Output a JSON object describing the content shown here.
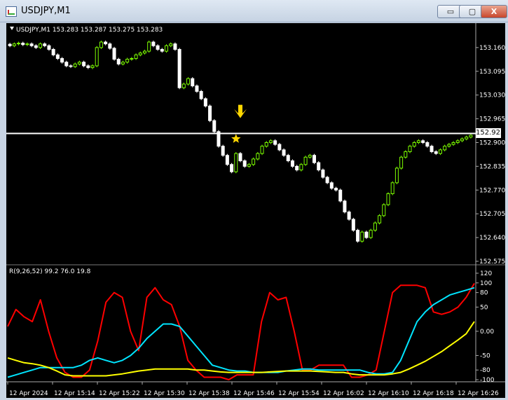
{
  "window": {
    "title": "USDJPY,M1",
    "buttons": {
      "minimize": "▭",
      "maximize": "▢",
      "close": "X"
    }
  },
  "colors": {
    "background": "#000000",
    "bull": "#7cfc00",
    "bear": "#ffffff",
    "red_line": "#ff0000",
    "cyan_line": "#00e5ff",
    "yellow_line": "#ffff00",
    "current_price_line": "#ffffff",
    "marker": "#ffd700"
  },
  "chart_data": [
    {
      "type": "candlestick",
      "title": "USDJPY,M1  153.283 153.287 153.275 153.283",
      "symbol": "USDJPY,M1",
      "ohlc_header": {
        "open": "153.283",
        "high": "153.287",
        "low": "153.275",
        "close": "153.283"
      },
      "ylim": [
        152.575,
        153.2
      ],
      "y_ticks": [
        "153.160",
        "153.095",
        "153.030",
        "152.965",
        "152.900",
        "152.835",
        "152.770",
        "152.705",
        "152.640",
        "152.575"
      ],
      "current_price": "152.925",
      "markers": [
        {
          "type": "arrow-down",
          "bar": 53,
          "price": 152.965
        },
        {
          "type": "star",
          "bar": 52,
          "price": 152.91
        }
      ],
      "closes": [
        153.165,
        153.17,
        153.172,
        153.168,
        153.17,
        153.165,
        153.16,
        153.17,
        153.165,
        153.155,
        153.14,
        153.13,
        153.12,
        153.11,
        153.108,
        153.115,
        153.12,
        153.11,
        153.105,
        153.11,
        153.16,
        153.175,
        153.17,
        153.158,
        153.128,
        153.115,
        153.12,
        153.128,
        153.13,
        153.14,
        153.145,
        153.15,
        153.175,
        153.165,
        153.155,
        153.15,
        153.165,
        153.17,
        153.155,
        153.05,
        153.06,
        153.075,
        153.055,
        153.04,
        153.02,
        153.0,
        152.96,
        152.93,
        152.89,
        152.865,
        152.84,
        152.82,
        152.87,
        152.85,
        152.835,
        152.84,
        152.855,
        152.87,
        152.89,
        152.9,
        152.905,
        152.895,
        152.88,
        152.865,
        152.85,
        152.835,
        152.825,
        152.84,
        152.86,
        152.865,
        152.845,
        152.825,
        152.805,
        152.79,
        152.775,
        152.77,
        152.74,
        152.71,
        152.69,
        152.66,
        152.63,
        152.655,
        152.64,
        152.66,
        152.68,
        152.7,
        152.73,
        152.76,
        152.79,
        152.83,
        152.86,
        152.875,
        152.89,
        152.9,
        152.905,
        152.9,
        152.89,
        152.875,
        152.87,
        152.88,
        152.89,
        152.895,
        152.9,
        152.905,
        152.91,
        152.915,
        152.92
      ]
    },
    {
      "type": "line",
      "title": "R(9,26,52) 99.2 76.0 19.8",
      "ylim": [
        -100,
        120
      ],
      "y_ticks": [
        "120",
        "100",
        "80",
        "50",
        "0.00",
        "-50",
        "-80",
        "-100"
      ],
      "x_tick_labels": [
        "12 Apr 2024",
        "12 Apr 15:14",
        "12 Apr 15:22",
        "12 Apr 15:30",
        "12 Apr 15:38",
        "12 Apr 15:46",
        "12 Apr 15:54",
        "12 Apr 16:02",
        "12 Apr 16:10",
        "12 Apr 16:18",
        "12 Apr 16:26"
      ],
      "series": [
        {
          "color": "#ff0000",
          "values": [
            10,
            45,
            30,
            20,
            65,
            0,
            -55,
            -85,
            -95,
            -95,
            -80,
            -20,
            60,
            80,
            70,
            0,
            -40,
            70,
            90,
            65,
            55,
            10,
            -60,
            -80,
            -95,
            -95,
            -95,
            -100,
            -90,
            -90,
            -90,
            20,
            80,
            65,
            70,
            0,
            -80,
            -80,
            -70,
            -70,
            -70,
            -70,
            -95,
            -95,
            -90,
            -80,
            0,
            80,
            95,
            95,
            95,
            90,
            40,
            35,
            40,
            50,
            70,
            99
          ]
        },
        {
          "color": "#00e5ff",
          "values": [
            -95,
            -90,
            -85,
            -80,
            -75,
            -75,
            -75,
            -75,
            -75,
            -70,
            -60,
            -55,
            -60,
            -65,
            -60,
            -50,
            -35,
            -15,
            0,
            15,
            15,
            10,
            -10,
            -30,
            -50,
            -70,
            -75,
            -80,
            -82,
            -82,
            -85,
            -85,
            -85,
            -85,
            -82,
            -80,
            -78,
            -78,
            -80,
            -80,
            -80,
            -80,
            -80,
            -80,
            -85,
            -88,
            -88,
            -85,
            -60,
            -20,
            20,
            40,
            55,
            65,
            75,
            80,
            85,
            90
          ]
        },
        {
          "color": "#ffff00",
          "values": [
            -55,
            -60,
            -65,
            -67,
            -70,
            -75,
            -82,
            -90,
            -92,
            -92,
            -92,
            -92,
            -92,
            -90,
            -88,
            -85,
            -82,
            -80,
            -78,
            -78,
            -78,
            -78,
            -78,
            -80,
            -80,
            -82,
            -84,
            -85,
            -85,
            -85,
            -85,
            -85,
            -84,
            -83,
            -82,
            -82,
            -82,
            -82,
            -83,
            -84,
            -85,
            -85,
            -88,
            -90,
            -90,
            -90,
            -90,
            -88,
            -85,
            -78,
            -70,
            -62,
            -52,
            -42,
            -30,
            -18,
            -5,
            20
          ]
        }
      ]
    }
  ]
}
